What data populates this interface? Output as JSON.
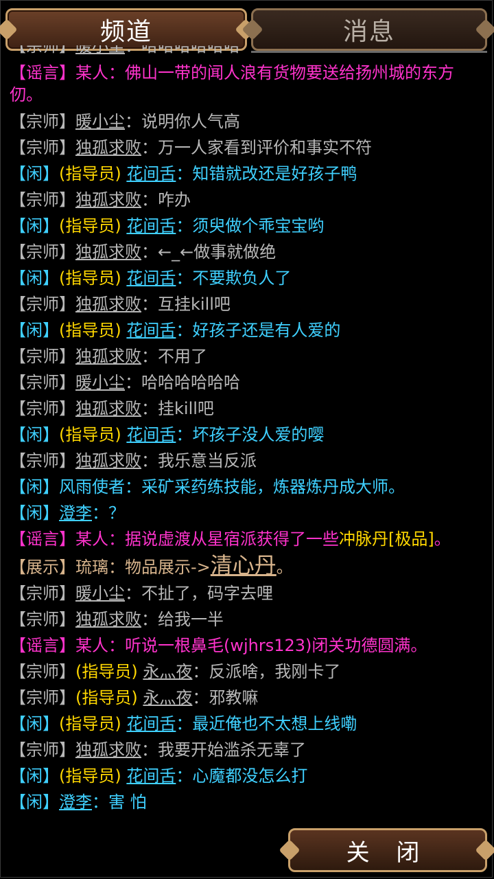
{
  "tabs": {
    "channel": "频道",
    "messages": "消息"
  },
  "close_label": "关 闭",
  "brackets": {
    "open": "【",
    "close": "】"
  },
  "channels": {
    "zongshi": "宗师",
    "xian": "闲",
    "yaoyan": "谣言",
    "zhanshi": "展示"
  },
  "guide_tag": "(指导员)",
  "first_partial": {
    "channel": "宗师",
    "name": "暖小尘",
    "text": "哈哈哈哈哈哈"
  },
  "msgs": [
    {
      "ch": "yaoyan",
      "name": "某人",
      "text": "佛山一带的闻人浪有货物要送给扬州城的东方仞。"
    },
    {
      "ch": "zongshi",
      "name": "暖小尘",
      "text": "说明你人气高"
    },
    {
      "ch": "zongshi",
      "name": "独孤求败",
      "text": "万一人家看到评价和事实不符"
    },
    {
      "ch": "xian",
      "guide": true,
      "name": "花间舌",
      "text": "知错就改还是好孩子鸭"
    },
    {
      "ch": "zongshi",
      "name": "独孤求败",
      "text": "咋办"
    },
    {
      "ch": "xian",
      "guide": true,
      "name": "花间舌",
      "text": "须臾做个乖宝宝哟"
    },
    {
      "ch": "zongshi",
      "name": "独孤求败",
      "text": "←_←做事就做绝"
    },
    {
      "ch": "xian",
      "guide": true,
      "name": "花间舌",
      "text": "不要欺负人了"
    },
    {
      "ch": "zongshi",
      "name": "独孤求败",
      "text": "互挂kill吧"
    },
    {
      "ch": "xian",
      "guide": true,
      "name": "花间舌",
      "text": "好孩子还是有人爱的"
    },
    {
      "ch": "zongshi",
      "name": "独孤求败",
      "text": "不用了"
    },
    {
      "ch": "zongshi",
      "name": "暖小尘",
      "text": "哈哈哈哈哈哈"
    },
    {
      "ch": "zongshi",
      "name": "独孤求败",
      "text": "挂kill吧"
    },
    {
      "ch": "xian",
      "guide": true,
      "name": "花间舌",
      "text": "坏孩子没人爱的嘤"
    },
    {
      "ch": "zongshi",
      "name": "独孤求败",
      "text": "我乐意当反派"
    },
    {
      "ch": "xian",
      "name": "风雨使者",
      "plain": true,
      "text": "采矿采药练技能，炼器炼丹成大师。"
    },
    {
      "ch": "xian",
      "name": "澄李",
      "text": "？"
    },
    {
      "ch": "yaoyan",
      "name": "某人",
      "text": "据说虚渡从星宿派获得了一些",
      "hl": "冲脉丹[极品]",
      "tail": "。"
    },
    {
      "ch": "zhanshi",
      "name": "琉璃",
      "text": "物品展示->",
      "item": "清心丹",
      "tail": "。"
    },
    {
      "ch": "zongshi",
      "name": "暖小尘",
      "text": "不扯了，码字去哩"
    },
    {
      "ch": "zongshi",
      "name": "独孤求败",
      "text": "给我一半"
    },
    {
      "ch": "yaoyan",
      "name": "某人",
      "text": "听说一根鼻毛(wjhrs123)闭关功德圆满。"
    },
    {
      "ch": "zongshi",
      "guide": true,
      "name": "永灬夜",
      "text": "反派啥，我刚卡了"
    },
    {
      "ch": "zongshi",
      "guide": true,
      "name": "永灬夜",
      "text": "邪教嘛"
    },
    {
      "ch": "xian",
      "guide": true,
      "name": "花间舌",
      "text": "最近俺也不太想上线嘞"
    },
    {
      "ch": "zongshi",
      "name": "独孤求败",
      "text": "我要开始滥杀无辜了"
    },
    {
      "ch": "xian",
      "guide": true,
      "name": "花间舌",
      "text": "心魔都没怎么打"
    },
    {
      "ch": "xian",
      "name": "澄李",
      "text": "害 怕"
    }
  ]
}
